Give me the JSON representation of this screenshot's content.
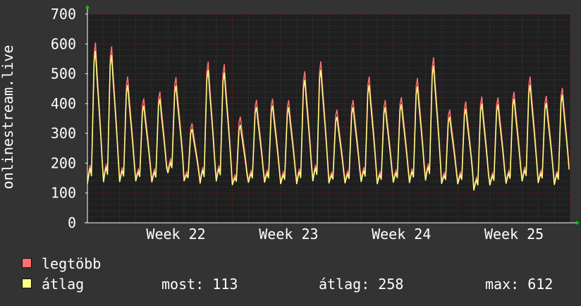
{
  "chart_data": {
    "type": "line",
    "ylabel": "onlinestream.live",
    "ylim": [
      0,
      700
    ],
    "y_ticks": [
      0,
      100,
      200,
      300,
      400,
      500,
      600,
      700
    ],
    "x_tick_labels": [
      "Week 22",
      "Week 23",
      "Week 24",
      "Week 25"
    ],
    "grid": true,
    "legend_position": "bottom-left",
    "days": 30,
    "daily_peaks_max": [
      645,
      630,
      520,
      440,
      465,
      515,
      350,
      575,
      565,
      375,
      435,
      440,
      435,
      540,
      575,
      400,
      435,
      520,
      435,
      445,
      515,
      590,
      400,
      430,
      450,
      445,
      465,
      520,
      450,
      480
    ],
    "daily_peaks_avg": [
      615,
      600,
      490,
      415,
      440,
      485,
      330,
      545,
      535,
      345,
      410,
      415,
      410,
      510,
      545,
      375,
      410,
      490,
      410,
      420,
      485,
      560,
      375,
      405,
      425,
      420,
      440,
      490,
      425,
      455
    ],
    "daily_low": [
      105,
      112,
      118,
      125,
      120,
      150,
      130,
      110,
      118,
      115,
      120,
      120,
      115,
      110,
      118,
      120,
      118,
      118,
      115,
      120,
      115,
      120,
      118,
      115,
      92,
      110,
      115,
      120,
      118,
      110
    ],
    "series": [
      {
        "name": "legtöbb",
        "color": "#ff7070"
      },
      {
        "name": "átlag",
        "color": "#ffff80"
      }
    ]
  },
  "legend": {
    "max_label": "legtöbb",
    "avg_label": "átlag",
    "most": "most: 113",
    "avg_stat": "átlag: 258",
    "max_stat": "max: 612"
  },
  "colors": {
    "background": "#333333",
    "plot_background": "#1f1f1f",
    "grid_major": "#a02020",
    "grid_minor": "#555555",
    "axis": "#ffffff",
    "arrow": "#00cc00"
  }
}
